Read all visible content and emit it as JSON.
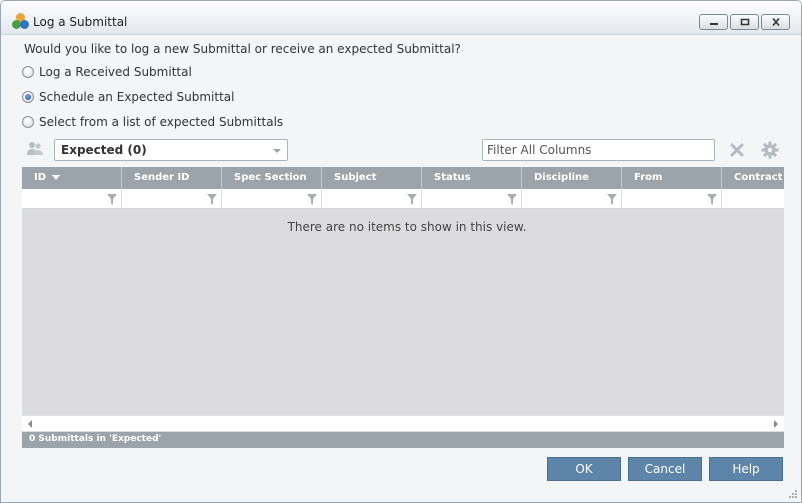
{
  "window": {
    "title": "Log a Submittal",
    "controls": [
      "minimize",
      "restore",
      "close"
    ]
  },
  "question": "Would you like to log a new Submittal or receive an expected Submittal?",
  "options": [
    {
      "label": "Log a Received Submittal",
      "checked": false
    },
    {
      "label": "Schedule an Expected Submittal",
      "checked": true
    },
    {
      "label": "Select from a list of expected Submittals",
      "checked": false
    }
  ],
  "toolbar": {
    "view_select": "Expected (0)",
    "filter_placeholder": "Filter All Columns"
  },
  "grid": {
    "columns": [
      "ID",
      "Sender ID",
      "Spec Section",
      "Subject",
      "Status",
      "Discipline",
      "From",
      "Contract"
    ],
    "sort_column": "ID",
    "empty_message": "There are no items to show in this view."
  },
  "status": "0 Submittals in 'Expected'",
  "buttons": {
    "ok": "OK",
    "cancel": "Cancel",
    "help": "Help"
  },
  "colors": {
    "accent": "#5d85a9",
    "header": "#9ba3ab",
    "grid_bg": "#dcdcde"
  }
}
